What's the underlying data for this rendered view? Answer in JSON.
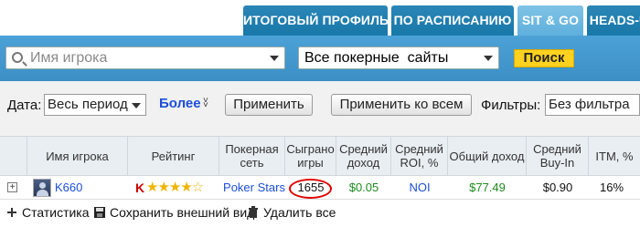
{
  "tabs": [
    {
      "label": "ИТОГОВЫЙ ПРОФИЛЬ",
      "active": false
    },
    {
      "label": "ПО РАСПИСАНИЮ",
      "active": false
    },
    {
      "label": "SIT & GO",
      "active": true
    },
    {
      "label": "HEADS-U",
      "active": false
    }
  ],
  "search": {
    "player_placeholder": "Имя игрока",
    "site_value": "Все покерные  сайты",
    "button": "Поиск"
  },
  "filters": {
    "date_label": "Дата:",
    "date_value": "Весь период",
    "more": "Более",
    "apply": "Применить",
    "apply_all": "Применить ко всем",
    "filters_label": "Фильтры:",
    "filters_value": "Без фильтра"
  },
  "table": {
    "headers": [
      "Имя игрока",
      "Рейтинг",
      "Покерная сеть",
      "Сыграно игры",
      "Средний доход",
      "Средний ROI, %",
      "Общий доход",
      "Средний Buy-In",
      "ITM, %"
    ],
    "row": {
      "player": "K660",
      "rating_prefix": "K",
      "rating_stars": "★★★★☆",
      "network": "Poker Stars",
      "games": "1655",
      "avg_income": "$0.05",
      "avg_roi": "NOI",
      "total_income": "$77.49",
      "avg_buyin": "$0.90",
      "itm": "16%"
    }
  },
  "footer": {
    "stats": "Статистика",
    "save_view": "Сохранить внешний вид",
    "delete_all": "Удалить все"
  },
  "colors": {
    "tab_bg": "#1878a8",
    "tab_active_bg": "#6bb8e0",
    "search_band": "#3b8fc6",
    "search_button": "#ffd21f",
    "money_green": "#1c8a1c",
    "link_blue": "#1c4fd8",
    "highlight_red": "#e00000"
  }
}
